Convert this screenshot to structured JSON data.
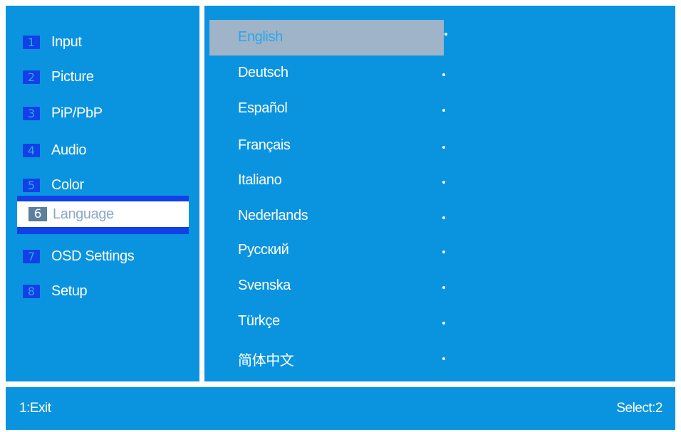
{
  "menu": {
    "items": [
      {
        "num": "1",
        "label": "Input"
      },
      {
        "num": "2",
        "label": "Picture"
      },
      {
        "num": "3",
        "label": "PiP/PbP"
      },
      {
        "num": "4",
        "label": "Audio"
      },
      {
        "num": "5",
        "label": "Color"
      },
      {
        "num": "6",
        "label": "Language"
      },
      {
        "num": "7",
        "label": "OSD Settings"
      },
      {
        "num": "8",
        "label": "Setup"
      }
    ],
    "selected_index": 6
  },
  "languages": {
    "items": [
      "English",
      "Deutsch",
      "Español",
      "Français",
      "Italiano",
      "Nederlands",
      "Русский",
      "Svenska",
      "Türkçe",
      "简体中文"
    ],
    "highlighted": "English"
  },
  "footer": {
    "left_text": "1:Exit",
    "right_text": "Select:2"
  },
  "colors": {
    "panel": "#0a94e0",
    "number_box": "#1040e6",
    "selected_row": "#ffffff",
    "highlight_bar": "#9fb4c8",
    "text": "#ffffff"
  }
}
